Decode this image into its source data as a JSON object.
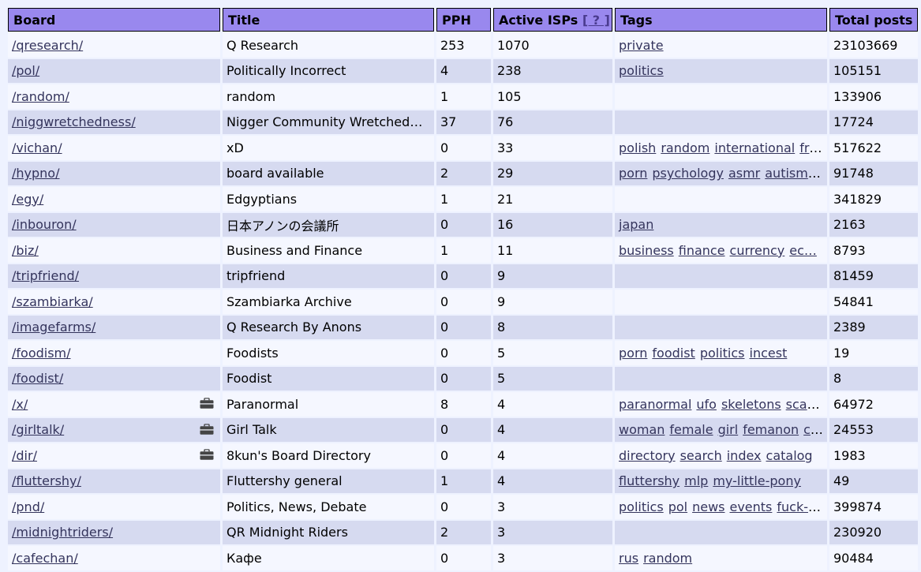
{
  "headers": {
    "board": "Board",
    "title": "Title",
    "pph": "PPH",
    "active_isps": "Active ISPs",
    "isp_help": "[ ? ]",
    "tags": "Tags",
    "total_posts": "Total posts"
  },
  "rows": [
    {
      "board": "/qresearch/",
      "title": "Q Research",
      "pph": "253",
      "isps": "1070",
      "tags": [
        "private"
      ],
      "posts": "23103669",
      "icon": false
    },
    {
      "board": "/pol/",
      "title": "Politically Incorrect",
      "pph": "4",
      "isps": "238",
      "tags": [
        "politics"
      ],
      "posts": "105151",
      "icon": false
    },
    {
      "board": "/random/",
      "title": "random",
      "pph": "1",
      "isps": "105",
      "tags": [],
      "posts": "133906",
      "icon": false
    },
    {
      "board": "/niggwretchedness/",
      "title": "Nigger Community Wretchedn…",
      "pph": "37",
      "isps": "76",
      "tags": [],
      "posts": "17724",
      "icon": false
    },
    {
      "board": "/vichan/",
      "title": "xD",
      "pph": "0",
      "isps": "33",
      "tags": [
        "polish",
        "random",
        "international",
        "fr…"
      ],
      "posts": "517622",
      "icon": false
    },
    {
      "board": "/hypno/",
      "title": "board available",
      "pph": "2",
      "isps": "29",
      "tags": [
        "porn",
        "psychology",
        "asmr",
        "autism…"
      ],
      "posts": "91748",
      "icon": false
    },
    {
      "board": "/egy/",
      "title": "Edgyptians",
      "pph": "1",
      "isps": "21",
      "tags": [],
      "posts": "341829",
      "icon": false
    },
    {
      "board": "/inbouron/",
      "title": "日本アノンの会議所",
      "pph": "0",
      "isps": "16",
      "tags": [
        "japan"
      ],
      "posts": "2163",
      "icon": false
    },
    {
      "board": "/biz/",
      "title": "Business and Finance",
      "pph": "1",
      "isps": "11",
      "tags": [
        "business",
        "finance",
        "currency",
        "ec…"
      ],
      "posts": "8793",
      "icon": false
    },
    {
      "board": "/tripfriend/",
      "title": "tripfriend",
      "pph": "0",
      "isps": "9",
      "tags": [],
      "posts": "81459",
      "icon": false
    },
    {
      "board": "/szambiarka/",
      "title": "Szambiarka Archive",
      "pph": "0",
      "isps": "9",
      "tags": [],
      "posts": "54841",
      "icon": false
    },
    {
      "board": "/imagefarms/",
      "title": "Q Research By Anons",
      "pph": "0",
      "isps": "8",
      "tags": [],
      "posts": "2389",
      "icon": false
    },
    {
      "board": "/foodism/",
      "title": "Foodists",
      "pph": "0",
      "isps": "5",
      "tags": [
        "porn",
        "foodist",
        "politics",
        "incest"
      ],
      "posts": "19",
      "icon": false
    },
    {
      "board": "/foodist/",
      "title": "Foodist",
      "pph": "0",
      "isps": "5",
      "tags": [],
      "posts": "8",
      "icon": false
    },
    {
      "board": "/x/",
      "title": "Paranormal",
      "pph": "8",
      "isps": "4",
      "tags": [
        "paranormal",
        "ufo",
        "skeletons",
        "sca…"
      ],
      "posts": "64972",
      "icon": true
    },
    {
      "board": "/girltalk/",
      "title": "Girl Talk",
      "pph": "0",
      "isps": "4",
      "tags": [
        "woman",
        "female",
        "girl",
        "femanon",
        "c…"
      ],
      "posts": "24553",
      "icon": true
    },
    {
      "board": "/dir/",
      "title": "8kun's Board Directory",
      "pph": "0",
      "isps": "4",
      "tags": [
        "directory",
        "search",
        "index",
        "catalog"
      ],
      "posts": "1983",
      "icon": true
    },
    {
      "board": "/fluttershy/",
      "title": "Fluttershy general",
      "pph": "1",
      "isps": "4",
      "tags": [
        "fluttershy",
        "mlp",
        "my-little-pony"
      ],
      "posts": "49",
      "icon": false
    },
    {
      "board": "/pnd/",
      "title": "Politics, News, Debate",
      "pph": "0",
      "isps": "3",
      "tags": [
        "politics",
        "pol",
        "news",
        "events",
        "fuck-…"
      ],
      "posts": "399874",
      "icon": false
    },
    {
      "board": "/midnightriders/",
      "title": "QR Midnight Riders",
      "pph": "2",
      "isps": "3",
      "tags": [],
      "posts": "230920",
      "icon": false
    },
    {
      "board": "/cafechan/",
      "title": "Кафе",
      "pph": "0",
      "isps": "3",
      "tags": [
        "rus",
        "random"
      ],
      "posts": "90484",
      "icon": false
    }
  ]
}
